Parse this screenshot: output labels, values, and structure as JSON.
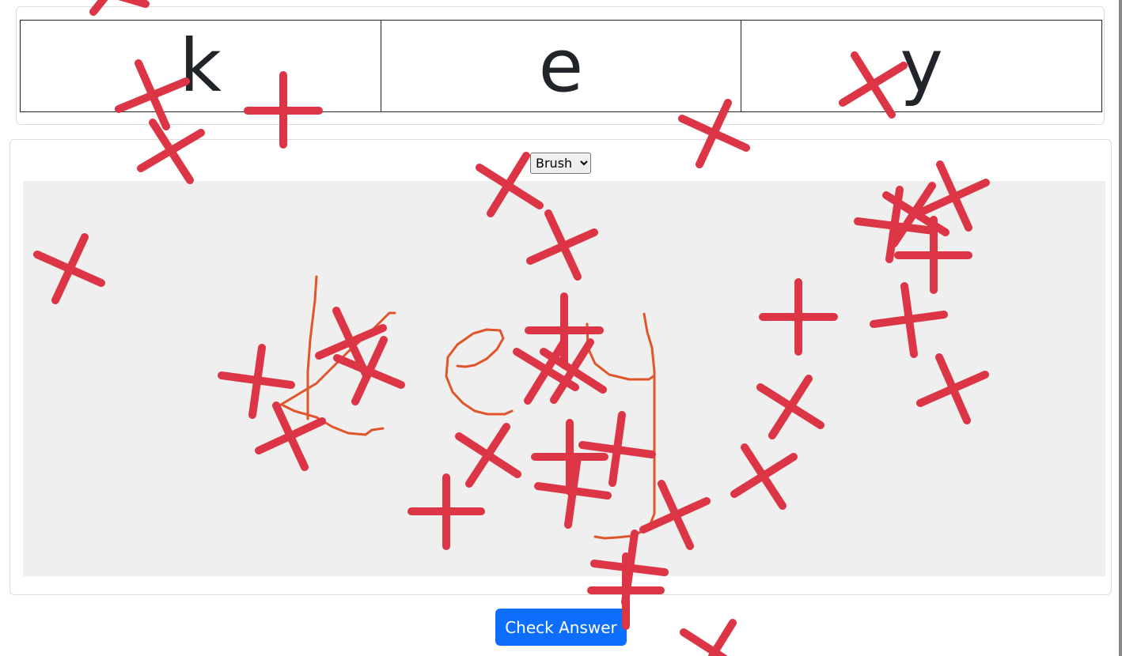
{
  "letters": [
    "k",
    "e",
    "y"
  ],
  "tool": {
    "selected": "Brush"
  },
  "check_button": {
    "label": "Check Answer"
  },
  "colors": {
    "primary_button": "#0d6efd",
    "drawing_stroke": "#e0552a",
    "mark_color": "#dc3545",
    "canvas_bg": "#efefef"
  }
}
